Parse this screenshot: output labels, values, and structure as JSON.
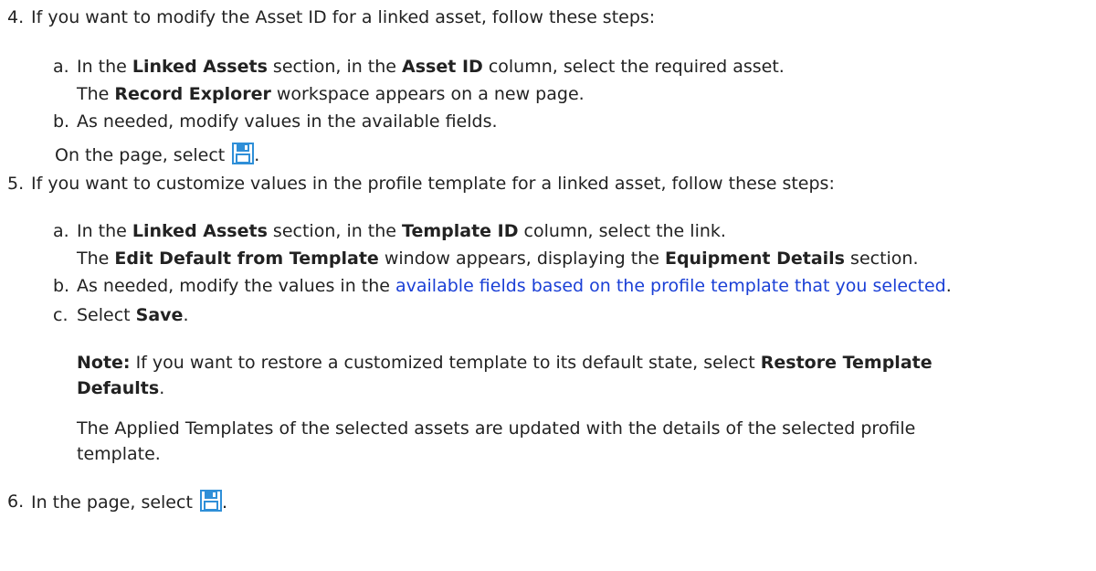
{
  "step4": {
    "num": "4.",
    "text": "If you want to modify the Asset ID for a linked asset, follow these steps:",
    "a": {
      "label": "a.",
      "t1": "In the ",
      "b1": "Linked Assets",
      "t2": " section, in the ",
      "b2": "Asset ID",
      "t3": " column, select the required asset.",
      "r_b": "Record Explorer",
      "r_t": " workspace appears on a new page."
    },
    "b": {
      "label": "b.",
      "text": "As needed, modify values in the available fields.",
      "on_text": "On the page, select ",
      "period": "."
    }
  },
  "step5": {
    "num": "5.",
    "text": "If you want to customize values in the profile template for a linked asset, follow these steps:",
    "a": {
      "label": "a.",
      "t1": "In the ",
      "b1": "Linked Assets",
      "t2": " section, in the ",
      "b2": "Template ID",
      "t3": " column, select the link.",
      "r_t1": "The ",
      "r_b1": "Edit Default from Template",
      "r_t2": " window appears, displaying the ",
      "r_b2": "Equipment Details",
      "r_t3": " section."
    },
    "b": {
      "label": "b.",
      "t1": "As needed, modify the values in the ",
      "link": "available fields based on the profile template that you selected",
      "t2": "."
    },
    "c": {
      "label": "c.",
      "t1": "Select ",
      "b1": "Save",
      "t2": "."
    },
    "note": {
      "label": "Note:",
      "t1": " If you want to restore a customized template to its default state, select ",
      "b1": "Restore Template",
      "b2": "Defaults",
      "t2": "."
    },
    "result": {
      "line1": "The Applied Templates of the selected assets are updated with the details of the selected profile",
      "line2": "template."
    }
  },
  "step6": {
    "num": "6.",
    "text": "In the page, select ",
    "period": "."
  },
  "icons": {
    "save": "save-icon"
  },
  "colors": {
    "link": "#1a3fd6",
    "icon": "#2f8fd8",
    "text": "#222222"
  }
}
